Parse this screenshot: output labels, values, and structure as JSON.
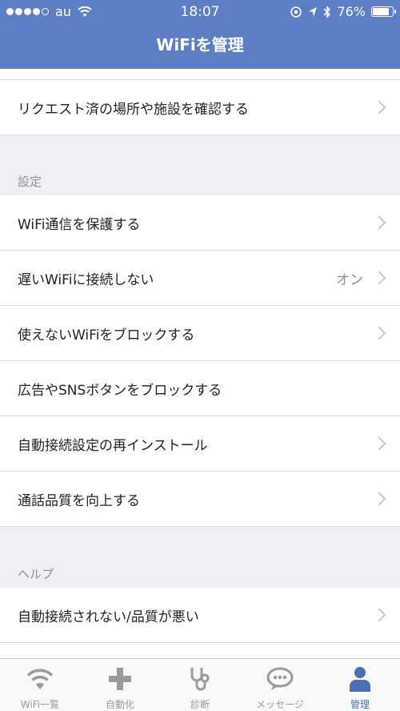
{
  "status_bar": {
    "carrier": "au",
    "time": "18:07",
    "battery": "76%",
    "battery_level": 0.76
  },
  "nav": {
    "title": "WiFiを管理"
  },
  "rows_top": [
    {
      "label": "リクエスト済の場所や施設を確認する",
      "chevron": true
    }
  ],
  "sections": [
    {
      "header": "設定",
      "rows": [
        {
          "label": "WiFi通信を保護する",
          "value": "",
          "chevron": true
        },
        {
          "label": "遅いWiFiに接続しない",
          "value": "オン",
          "chevron": true
        },
        {
          "label": "使えないWiFiをブロックする",
          "value": "",
          "chevron": true
        },
        {
          "label": "広告やSNSボタンをブロックする",
          "value": "",
          "chevron": false
        },
        {
          "label": "自動接続設定の再インストール",
          "value": "",
          "chevron": true
        },
        {
          "label": "通話品質を向上する",
          "value": "",
          "chevron": true
        }
      ]
    },
    {
      "header": "ヘルプ",
      "rows": [
        {
          "label": "自動接続されない/品質が悪い",
          "value": "",
          "chevron": true
        }
      ]
    }
  ],
  "tabbar": {
    "tabs": [
      {
        "label": "WiFi一覧",
        "icon": "wifi-icon"
      },
      {
        "label": "自動化",
        "icon": "plus-icon"
      },
      {
        "label": "診断",
        "icon": "stethoscope-icon"
      },
      {
        "label": "メッセージ",
        "icon": "chat-bubble-icon"
      },
      {
        "label": "管理",
        "icon": "person-icon",
        "active": true
      }
    ],
    "inactive_color": "#9a9a9a",
    "active_color": "#4a6fb5"
  },
  "colors": {
    "header": "#5b7ec4",
    "background": "#efeff4"
  }
}
